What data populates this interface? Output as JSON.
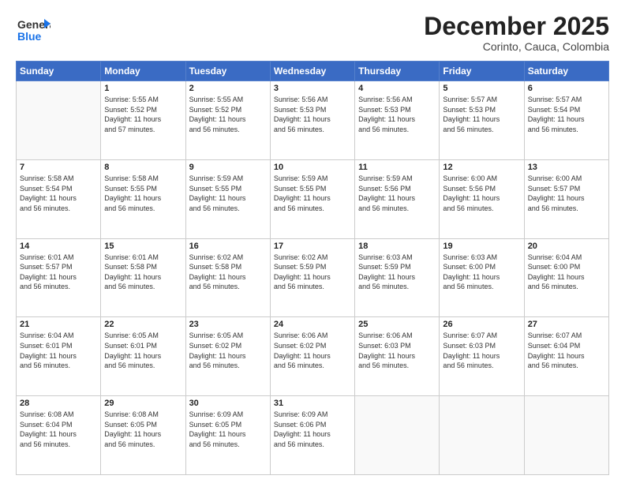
{
  "header": {
    "logo_line1": "General",
    "logo_line2": "Blue",
    "month": "December 2025",
    "location": "Corinto, Cauca, Colombia"
  },
  "days_of_week": [
    "Sunday",
    "Monday",
    "Tuesday",
    "Wednesday",
    "Thursday",
    "Friday",
    "Saturday"
  ],
  "weeks": [
    [
      {
        "num": "",
        "empty": true
      },
      {
        "num": "1",
        "sunrise": "5:55 AM",
        "sunset": "5:52 PM",
        "daylight": "11 hours and 57 minutes."
      },
      {
        "num": "2",
        "sunrise": "5:55 AM",
        "sunset": "5:52 PM",
        "daylight": "11 hours and 56 minutes."
      },
      {
        "num": "3",
        "sunrise": "5:56 AM",
        "sunset": "5:53 PM",
        "daylight": "11 hours and 56 minutes."
      },
      {
        "num": "4",
        "sunrise": "5:56 AM",
        "sunset": "5:53 PM",
        "daylight": "11 hours and 56 minutes."
      },
      {
        "num": "5",
        "sunrise": "5:57 AM",
        "sunset": "5:53 PM",
        "daylight": "11 hours and 56 minutes."
      },
      {
        "num": "6",
        "sunrise": "5:57 AM",
        "sunset": "5:54 PM",
        "daylight": "11 hours and 56 minutes."
      }
    ],
    [
      {
        "num": "7",
        "sunrise": "5:58 AM",
        "sunset": "5:54 PM",
        "daylight": "11 hours and 56 minutes."
      },
      {
        "num": "8",
        "sunrise": "5:58 AM",
        "sunset": "5:55 PM",
        "daylight": "11 hours and 56 minutes."
      },
      {
        "num": "9",
        "sunrise": "5:59 AM",
        "sunset": "5:55 PM",
        "daylight": "11 hours and 56 minutes."
      },
      {
        "num": "10",
        "sunrise": "5:59 AM",
        "sunset": "5:55 PM",
        "daylight": "11 hours and 56 minutes."
      },
      {
        "num": "11",
        "sunrise": "5:59 AM",
        "sunset": "5:56 PM",
        "daylight": "11 hours and 56 minutes."
      },
      {
        "num": "12",
        "sunrise": "6:00 AM",
        "sunset": "5:56 PM",
        "daylight": "11 hours and 56 minutes."
      },
      {
        "num": "13",
        "sunrise": "6:00 AM",
        "sunset": "5:57 PM",
        "daylight": "11 hours and 56 minutes."
      }
    ],
    [
      {
        "num": "14",
        "sunrise": "6:01 AM",
        "sunset": "5:57 PM",
        "daylight": "11 hours and 56 minutes."
      },
      {
        "num": "15",
        "sunrise": "6:01 AM",
        "sunset": "5:58 PM",
        "daylight": "11 hours and 56 minutes."
      },
      {
        "num": "16",
        "sunrise": "6:02 AM",
        "sunset": "5:58 PM",
        "daylight": "11 hours and 56 minutes."
      },
      {
        "num": "17",
        "sunrise": "6:02 AM",
        "sunset": "5:59 PM",
        "daylight": "11 hours and 56 minutes."
      },
      {
        "num": "18",
        "sunrise": "6:03 AM",
        "sunset": "5:59 PM",
        "daylight": "11 hours and 56 minutes."
      },
      {
        "num": "19",
        "sunrise": "6:03 AM",
        "sunset": "6:00 PM",
        "daylight": "11 hours and 56 minutes."
      },
      {
        "num": "20",
        "sunrise": "6:04 AM",
        "sunset": "6:00 PM",
        "daylight": "11 hours and 56 minutes."
      }
    ],
    [
      {
        "num": "21",
        "sunrise": "6:04 AM",
        "sunset": "6:01 PM",
        "daylight": "11 hours and 56 minutes."
      },
      {
        "num": "22",
        "sunrise": "6:05 AM",
        "sunset": "6:01 PM",
        "daylight": "11 hours and 56 minutes."
      },
      {
        "num": "23",
        "sunrise": "6:05 AM",
        "sunset": "6:02 PM",
        "daylight": "11 hours and 56 minutes."
      },
      {
        "num": "24",
        "sunrise": "6:06 AM",
        "sunset": "6:02 PM",
        "daylight": "11 hours and 56 minutes."
      },
      {
        "num": "25",
        "sunrise": "6:06 AM",
        "sunset": "6:03 PM",
        "daylight": "11 hours and 56 minutes."
      },
      {
        "num": "26",
        "sunrise": "6:07 AM",
        "sunset": "6:03 PM",
        "daylight": "11 hours and 56 minutes."
      },
      {
        "num": "27",
        "sunrise": "6:07 AM",
        "sunset": "6:04 PM",
        "daylight": "11 hours and 56 minutes."
      }
    ],
    [
      {
        "num": "28",
        "sunrise": "6:08 AM",
        "sunset": "6:04 PM",
        "daylight": "11 hours and 56 minutes."
      },
      {
        "num": "29",
        "sunrise": "6:08 AM",
        "sunset": "6:05 PM",
        "daylight": "11 hours and 56 minutes."
      },
      {
        "num": "30",
        "sunrise": "6:09 AM",
        "sunset": "6:05 PM",
        "daylight": "11 hours and 56 minutes."
      },
      {
        "num": "31",
        "sunrise": "6:09 AM",
        "sunset": "6:06 PM",
        "daylight": "11 hours and 56 minutes."
      },
      {
        "num": "",
        "empty": true
      },
      {
        "num": "",
        "empty": true
      },
      {
        "num": "",
        "empty": true
      }
    ]
  ]
}
